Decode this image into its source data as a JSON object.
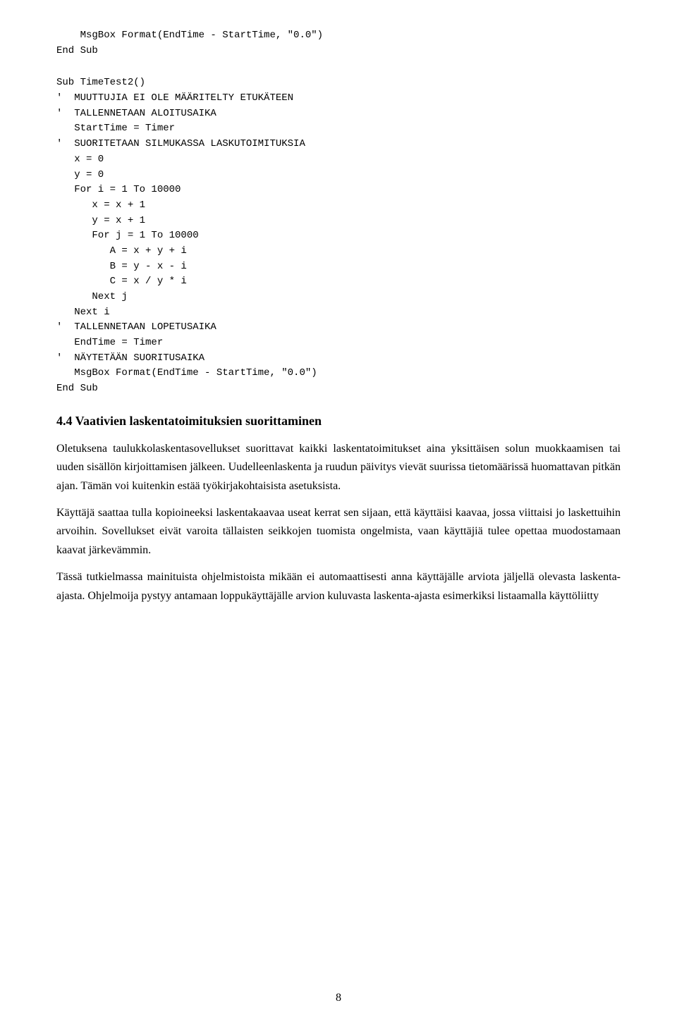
{
  "page": {
    "number": "8",
    "code_block_1": "    MsgBox Format(EndTime - StartTime, \"0.0\")\nEnd Sub",
    "code_block_2": "Sub TimeTest2()\n'  MUUTTUJIA EI OLE MÄÄRITELTY ETUKÄTEEN\n'  TALLENNETAAN ALOITUSAIKA\n   StartTime = Timer\n'  SUORITETAAN SILMUKASSA LASKUTOIMITUKSIA\n   x = 0\n   y = 0\n   For i = 1 To 10000\n      x = x + 1\n      y = x + 1\n      For j = 1 To 10000\n         A = x + y + i\n         B = y - x - i\n         C = x / y * i\n      Next j\n   Next i\n'  TALLENNETAAN LOPETUSAIKA\n   EndTime = Timer\n'  NÄYTETÄÄN SUORITUSAIKA\n   MsgBox Format(EndTime - StartTime, \"0.0\")\nEnd Sub",
    "section_heading": "4.4 Vaativien laskentatoimituksien suorittaminen",
    "paragraphs": [
      "Oletuksena taulukkolaskentasovellukset suorittavat kaikki laskentatoimitukset ai­na yksittäisen solun muokkaamisen tai uuden sisällön kirjoittamisen jälkeen. Uu­delleenlaskenta ja ruudun päivitys vievät suurissa tietomäärissä huomattavan pit­kän ajan. Tämän voi kuitenkin estää työkirjakohtaisista asetuksista.",
      "Käyttäjä saattaa tulla kopioineeksi laskentakaavaa useat kerrat sen sijaan, että käyttäisi kaavaa, jossa viittaisi jo laskettuihin arvoihin. Sovellukset eivät varoita täl­laisten seikkojen tuomista ongelmista, vaan käyttäjiä tulee opettaa muodostamaan kaavat järkevämmin.",
      "Tässä tutkielmassa mainituista ohjelmistoista mikään ei automaattisesti anna käyttäjälle arviota jäljellä olevasta laskenta-ajasta. Ohjelmoija pystyy antamaan lop­pukäyttäjälle arvion kuluvasta laskenta-ajasta esimerkiksi listaamalla käyttöliitty­"
    ]
  }
}
